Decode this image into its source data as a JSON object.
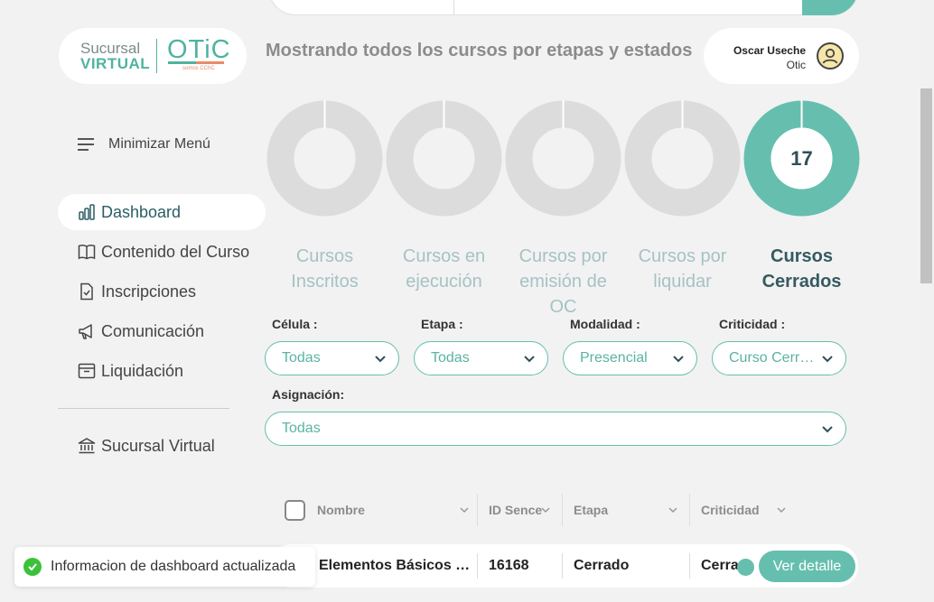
{
  "logo": {
    "line1": "Sucursal",
    "line2": "VIRTUAL",
    "brand": "OTiC",
    "brand_sub": "somos CChC"
  },
  "header": {
    "title": "Mostrando todos los cursos por etapas y estados"
  },
  "user": {
    "name": "Oscar Useche",
    "org": "Otic",
    "avatar_icon": "user-circle-icon"
  },
  "sidebar": {
    "toggle_label": "Minimizar Menú",
    "items": [
      {
        "label": "Dashboard",
        "icon": "bar-chart-icon",
        "active": true
      },
      {
        "label": "Contenido del Curso",
        "icon": "book-icon",
        "active": false
      },
      {
        "label": "Inscripciones",
        "icon": "document-check-icon",
        "active": false
      },
      {
        "label": "Comunicación",
        "icon": "megaphone-icon",
        "active": false
      },
      {
        "label": "Liquidación",
        "icon": "archive-box-icon",
        "active": false
      }
    ],
    "bottom_item": {
      "label": "Sucursal Virtual",
      "icon": "bank-icon"
    }
  },
  "stages": [
    {
      "label_line1": "Cursos",
      "label_line2": "Inscritos",
      "count": "",
      "active": false
    },
    {
      "label_line1": "Cursos en",
      "label_line2": "ejecución",
      "count": "",
      "active": false
    },
    {
      "label_line1": "Cursos por",
      "label_line2": "emisión de OC",
      "count": "",
      "active": false
    },
    {
      "label_line1": "Cursos por",
      "label_line2": "liquidar",
      "count": "",
      "active": false
    },
    {
      "label_line1": "Cursos",
      "label_line2": "Cerrados",
      "count": "17",
      "active": true
    }
  ],
  "filters": {
    "celula": {
      "label": "Célula :",
      "value": "Todas"
    },
    "etapa": {
      "label": "Etapa :",
      "value": "Todas"
    },
    "modalidad": {
      "label": "Modalidad :",
      "value": "Presencial"
    },
    "criticidad": {
      "label": "Criticidad :",
      "value": "Curso Cerrado"
    },
    "asignacion": {
      "label": "Asignación:",
      "value": "Todas"
    }
  },
  "table": {
    "columns": [
      "Nombre",
      "ID Sence",
      "Etapa",
      "Criticidad"
    ],
    "rows": [
      {
        "nombre": "Elementos Básicos y Desarrollo",
        "id_sence": "16168",
        "etapa": "Cerrado",
        "criticidad": "Cerrado",
        "action": "Ver detalle"
      }
    ]
  },
  "toast": {
    "message": "Informacion de dashboard actualizada"
  },
  "colors": {
    "accent": "#66bfae",
    "inactive_ring": "#dcdcdc",
    "active_text": "#355a60"
  }
}
